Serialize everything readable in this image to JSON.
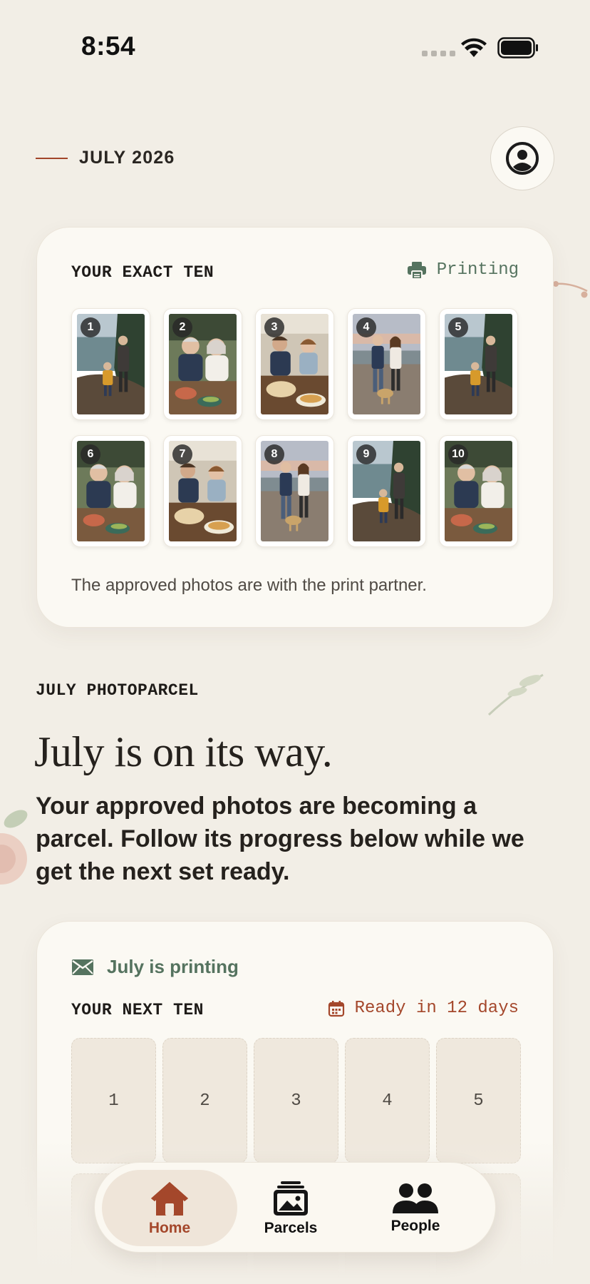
{
  "status_bar": {
    "time": "8:54"
  },
  "header": {
    "month": "JULY 2026"
  },
  "exact_ten": {
    "title": "YOUR EXACT TEN",
    "status": "Printing",
    "photos": [
      "1",
      "2",
      "3",
      "4",
      "5",
      "6",
      "7",
      "8",
      "9",
      "10"
    ],
    "note": "The approved photos are with the print partner."
  },
  "parcel": {
    "section_label": "JULY PHOTOPARCEL",
    "headline": "July is on its way.",
    "subheading": "Your approved photos are becoming a parcel. Follow its progress below while we get the next set ready."
  },
  "next_ten": {
    "status": "July is printing",
    "title": "YOUR NEXT TEN",
    "ready": "Ready in 12 days",
    "slots": [
      "1",
      "2",
      "3",
      "4",
      "5"
    ]
  },
  "nav": {
    "home": "Home",
    "parcels": "Parcels",
    "people": "People"
  },
  "colors": {
    "accent": "#a4472b",
    "green": "#55735f",
    "background": "#f2eee6",
    "card": "#fbf9f3"
  }
}
